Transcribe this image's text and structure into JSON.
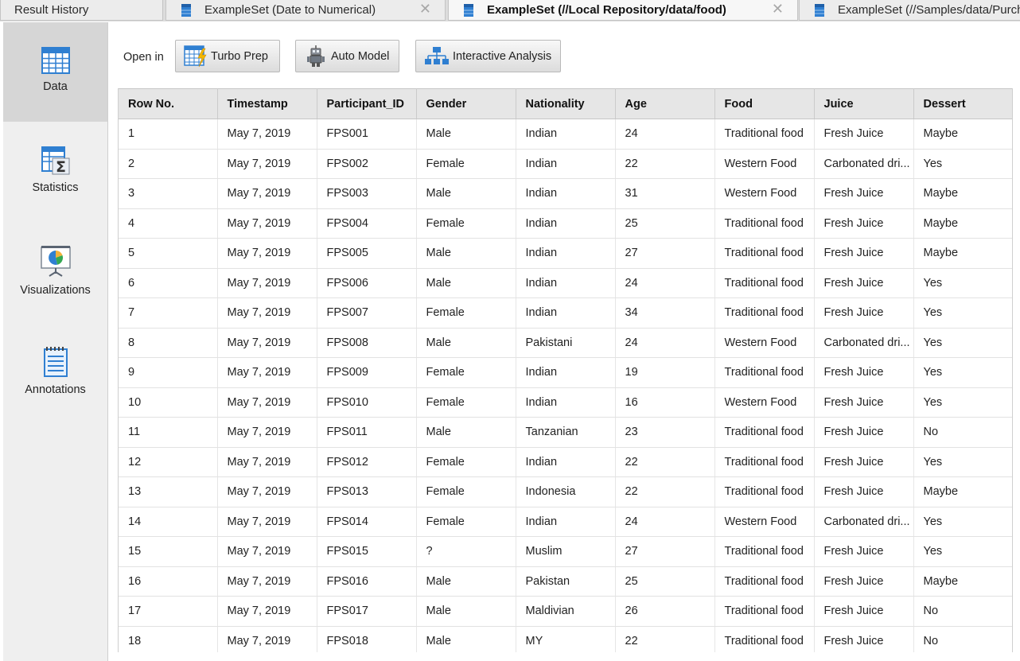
{
  "tabs": [
    {
      "label": "Result History",
      "active": false,
      "closable": false
    },
    {
      "label": "ExampleSet (Date to Numerical)",
      "active": false,
      "closable": true
    },
    {
      "label": "ExampleSet (//Local Repository/data/food)",
      "active": true,
      "closable": true
    },
    {
      "label": "ExampleSet (//Samples/data/Purchases)",
      "active": false,
      "closable": true
    }
  ],
  "close_glyph": "✕",
  "sidebar": {
    "items": [
      {
        "label": "Data",
        "icon": "table-grid-icon",
        "selected": true
      },
      {
        "label": "Statistics",
        "icon": "statistics-sigma-icon",
        "selected": false
      },
      {
        "label": "Visualizations",
        "icon": "presentation-chart-icon",
        "selected": false
      },
      {
        "label": "Annotations",
        "icon": "notepad-icon",
        "selected": false
      }
    ]
  },
  "toolbar": {
    "open_in_label": "Open in",
    "buttons": [
      {
        "label": "Turbo Prep",
        "icon": "turbo-prep-icon"
      },
      {
        "label": "Auto Model",
        "icon": "robot-icon"
      },
      {
        "label": "Interactive Analysis",
        "icon": "hierarchy-icon"
      }
    ]
  },
  "table": {
    "columns": [
      "Row No.",
      "Timestamp",
      "Participant_ID",
      "Gender",
      "Nationality",
      "Age",
      "Food",
      "Juice",
      "Dessert"
    ],
    "rows": [
      [
        "1",
        "May 7, 2019",
        "FPS001",
        "Male",
        "Indian",
        "24",
        "Traditional food",
        "Fresh Juice",
        "Maybe"
      ],
      [
        "2",
        "May 7, 2019",
        "FPS002",
        "Female",
        "Indian",
        "22",
        "Western Food",
        "Carbonated dri...",
        "Yes"
      ],
      [
        "3",
        "May 7, 2019",
        "FPS003",
        "Male",
        "Indian",
        "31",
        "Western Food",
        "Fresh Juice",
        "Maybe"
      ],
      [
        "4",
        "May 7, 2019",
        "FPS004",
        "Female",
        "Indian",
        "25",
        "Traditional food",
        "Fresh Juice",
        "Maybe"
      ],
      [
        "5",
        "May 7, 2019",
        "FPS005",
        "Male",
        "Indian",
        "27",
        "Traditional food",
        "Fresh Juice",
        "Maybe"
      ],
      [
        "6",
        "May 7, 2019",
        "FPS006",
        "Male",
        "Indian",
        "24",
        "Traditional food",
        "Fresh Juice",
        "Yes"
      ],
      [
        "7",
        "May 7, 2019",
        "FPS007",
        "Female",
        "Indian",
        "34",
        "Traditional food",
        "Fresh Juice",
        "Yes"
      ],
      [
        "8",
        "May 7, 2019",
        "FPS008",
        "Male",
        "Pakistani",
        "24",
        "Western Food",
        "Carbonated dri...",
        "Yes"
      ],
      [
        "9",
        "May 7, 2019",
        "FPS009",
        "Female",
        "Indian",
        "19",
        "Traditional food",
        "Fresh Juice",
        "Yes"
      ],
      [
        "10",
        "May 7, 2019",
        "FPS010",
        "Female",
        "Indian",
        "16",
        "Western Food",
        "Fresh Juice",
        "Yes"
      ],
      [
        "11",
        "May 7, 2019",
        "FPS011",
        "Male",
        "Tanzanian",
        "23",
        "Traditional food",
        "Fresh Juice",
        "No"
      ],
      [
        "12",
        "May 7, 2019",
        "FPS012",
        "Female",
        "Indian",
        "22",
        "Traditional food",
        "Fresh Juice",
        "Yes"
      ],
      [
        "13",
        "May 7, 2019",
        "FPS013",
        "Female",
        "Indonesia",
        "22",
        "Traditional food",
        "Fresh Juice",
        "Maybe"
      ],
      [
        "14",
        "May 7, 2019",
        "FPS014",
        "Female",
        "Indian",
        "24",
        "Western Food",
        "Carbonated dri...",
        "Yes"
      ],
      [
        "15",
        "May 7, 2019",
        "FPS015",
        "?",
        "Muslim",
        "27",
        "Traditional food",
        "Fresh Juice",
        "Yes"
      ],
      [
        "16",
        "May 7, 2019",
        "FPS016",
        "Male",
        "Pakistan",
        "25",
        "Traditional food",
        "Fresh Juice",
        "Maybe"
      ],
      [
        "17",
        "May 7, 2019",
        "FPS017",
        "Male",
        "Maldivian",
        "26",
        "Traditional food",
        "Fresh Juice",
        "No"
      ],
      [
        "18",
        "May 7, 2019",
        "FPS018",
        "Male",
        "MY",
        "22",
        "Traditional food",
        "Fresh Juice",
        "No"
      ]
    ]
  },
  "colors": {
    "accent_blue": "#2f7fd1",
    "tab_active_bg": "#f7f7f7",
    "sidebar_selected_bg": "#d6d6d6",
    "header_bg": "#e6e6e6"
  }
}
